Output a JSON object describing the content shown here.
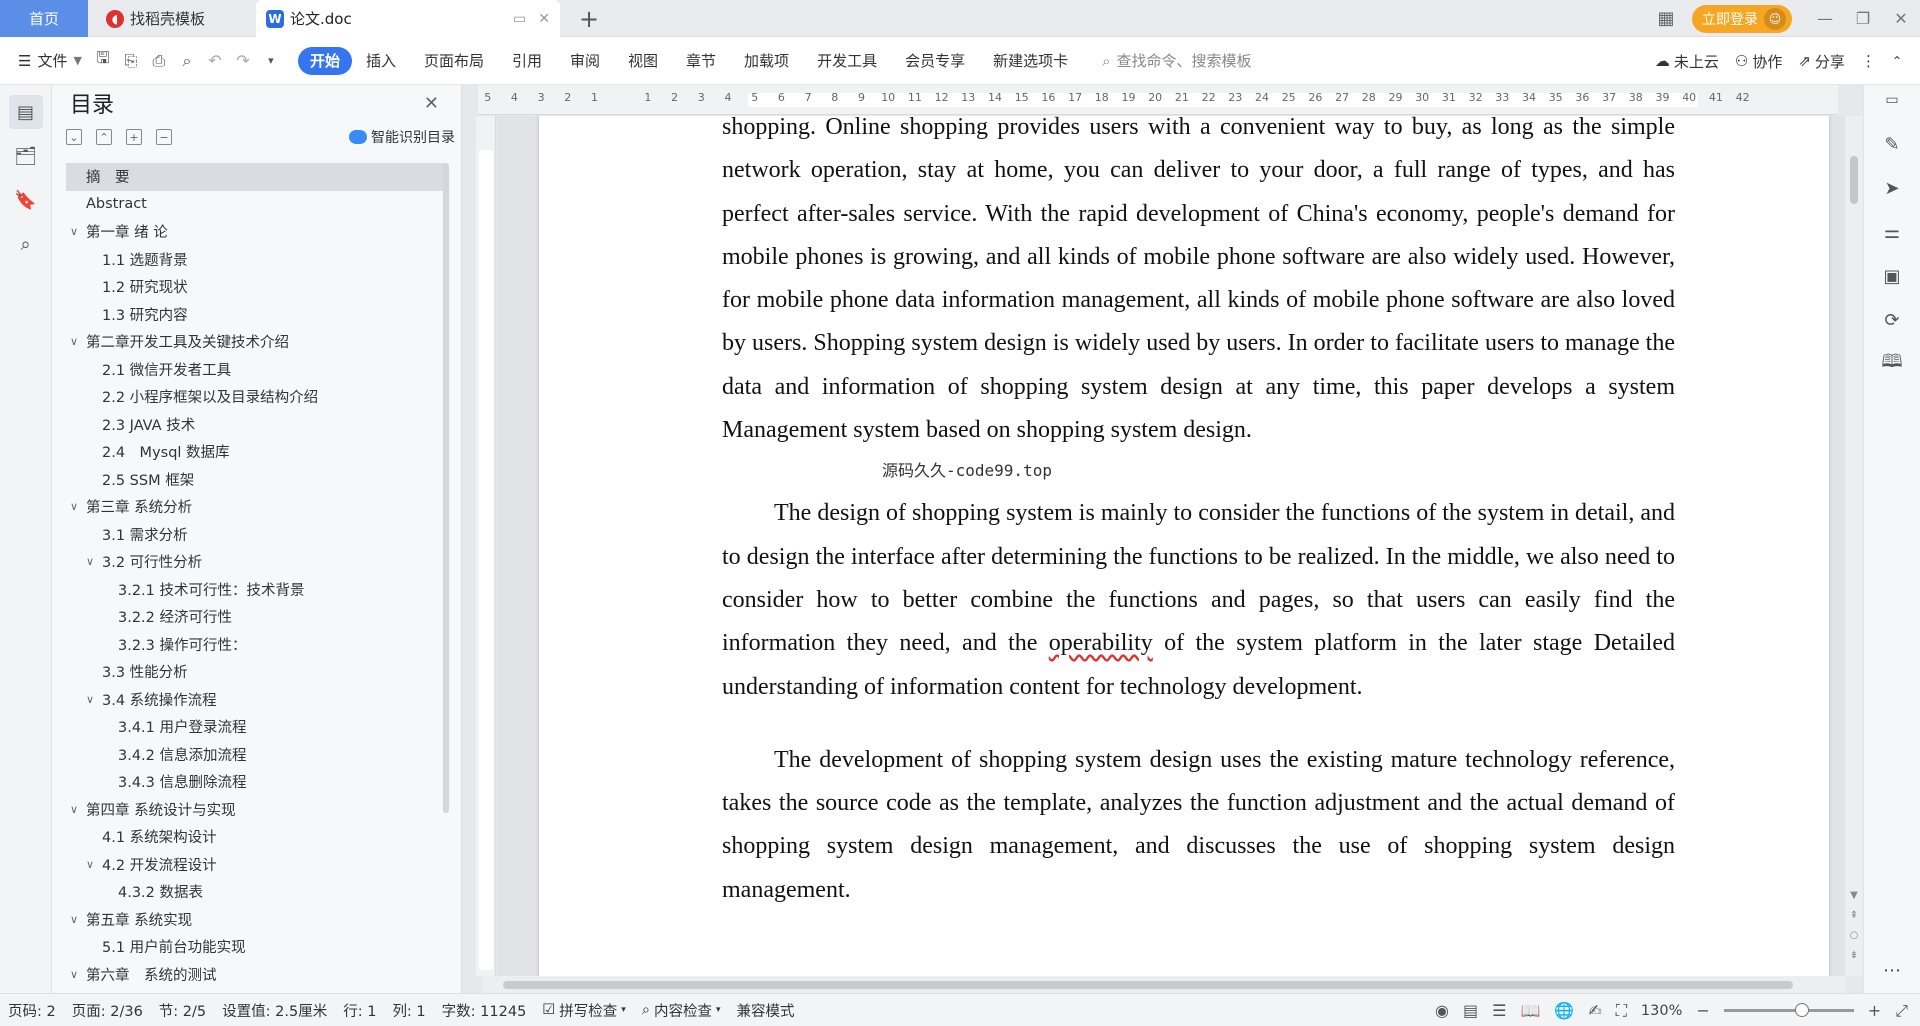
{
  "tabs": {
    "home": "首页",
    "template": "找稻壳模板",
    "doc": "论文.doc",
    "doc_tools": [
      "▭",
      "✕"
    ],
    "new_tab": "+"
  },
  "header_right": {
    "login_label": "立即登录"
  },
  "menubar": {
    "file_label": "文件",
    "items": [
      "开始",
      "插入",
      "页面布局",
      "引用",
      "审阅",
      "视图",
      "章节",
      "加载项",
      "开发工具",
      "会员专享",
      "新建选项卡"
    ],
    "active_index": 0,
    "search_placeholder": "查找命令、搜索模板",
    "cloud_label": "未上云",
    "collab_label": "协作",
    "share_label": "分享"
  },
  "toc": {
    "title": "目录",
    "smart_label": "智能识别目录",
    "items": [
      {
        "label": "摘　要",
        "level": 1,
        "expand": false,
        "selected": true
      },
      {
        "label": "Abstract",
        "level": 1,
        "expand": false
      },
      {
        "label": "第一章 绪 论",
        "level": 1,
        "expand": true
      },
      {
        "label": "1.1 选题背景",
        "level": 2,
        "expand": false
      },
      {
        "label": "1.2 研究现状",
        "level": 2,
        "expand": false
      },
      {
        "label": "1.3 研究内容",
        "level": 2,
        "expand": false
      },
      {
        "label": "第二章开发工具及关键技术介绍",
        "level": 1,
        "expand": true
      },
      {
        "label": "2.1 微信开发者工具",
        "level": 2,
        "expand": false
      },
      {
        "label": "2.2 小程序框架以及目录结构介绍",
        "level": 2,
        "expand": false
      },
      {
        "label": "2.3 JAVA 技术",
        "level": 2,
        "expand": false
      },
      {
        "label": "2.4　Mysql 数据库",
        "level": 2,
        "expand": false
      },
      {
        "label": "2.5 SSM 框架",
        "level": 2,
        "expand": false
      },
      {
        "label": "第三章 系统分析",
        "level": 1,
        "expand": true
      },
      {
        "label": "3.1 需求分析",
        "level": 2,
        "expand": false
      },
      {
        "label": "3.2 可行性分析",
        "level": 2,
        "expand": true
      },
      {
        "label": "3.2.1 技术可行性：技术背景",
        "level": 3,
        "expand": false
      },
      {
        "label": "3.2.2 经济可行性",
        "level": 3,
        "expand": false
      },
      {
        "label": "3.2.3 操作可行性：",
        "level": 3,
        "expand": false
      },
      {
        "label": "3.3 性能分析",
        "level": 2,
        "expand": false
      },
      {
        "label": "3.4 系统操作流程",
        "level": 2,
        "expand": true
      },
      {
        "label": "3.4.1 用户登录流程",
        "level": 3,
        "expand": false
      },
      {
        "label": "3.4.2 信息添加流程",
        "level": 3,
        "expand": false
      },
      {
        "label": "3.4.3 信息删除流程",
        "level": 3,
        "expand": false
      },
      {
        "label": "第四章 系统设计与实现",
        "level": 1,
        "expand": true
      },
      {
        "label": "4.1 系统架构设计",
        "level": 2,
        "expand": false
      },
      {
        "label": "4.2 开发流程设计",
        "level": 2,
        "expand": true
      },
      {
        "label": "4.3.2 数据表",
        "level": 3,
        "expand": false
      },
      {
        "label": "第五章 系统实现",
        "level": 1,
        "expand": true
      },
      {
        "label": "5.1 用户前台功能实现",
        "level": 2,
        "expand": false
      },
      {
        "label": "第六章　系统的测试",
        "level": 1,
        "expand": true
      }
    ]
  },
  "ruler": {
    "ticks": [
      "6",
      "5",
      "4",
      "3",
      "2",
      "1",
      "",
      "1",
      "2",
      "3",
      "4",
      "5",
      "6",
      "7",
      "8",
      "9",
      "10",
      "11",
      "12",
      "13",
      "14",
      "15",
      "16",
      "17",
      "18",
      "19",
      "20",
      "21",
      "22",
      "23",
      "24",
      "25",
      "26",
      "27",
      "28",
      "29",
      "30",
      "31",
      "32",
      "33",
      "34",
      "35",
      "36",
      "37",
      "38",
      "39",
      "40",
      "41",
      "42"
    ]
  },
  "document": {
    "para1": "shopping. Online shopping provides users with a convenient way to buy, as long as the simple network operation, stay at home, you can deliver to your door, a full range of types, and has perfect after-sales service. With the rapid development of China's economy, people's demand for mobile phones is growing, and all kinds of mobile phone software are also widely used. However, for mobile phone data information management, all kinds of mobile phone software are also loved by users. Shopping system design is widely used by users. In order to facilitate users to manage the data and information of shopping system design at any time, this paper develops a system Management system based on shopping system design.",
    "watermark": "源码久久-code99.top",
    "para2_a": "The design of shopping system is mainly to consider the functions of the system in detail, and to design the interface after determining the functions to be realized. In the middle, we also need to consider how to better combine the functions and pages, so that users can easily find the information they need, and the ",
    "para2_misspelled": "operability",
    "para2_b": " of the system platform in the later stage Detailed understanding of information content for technology development.",
    "para3": "The development of shopping system design uses the existing mature technology reference, takes the source code as the template, analyzes the function adjustment and the actual demand of shopping system design management, and discusses the use of shopping system design management."
  },
  "statusbar": {
    "page_no": "页码: 2",
    "page": "页面: 2/36",
    "section": "节: 2/5",
    "setting": "设置值: 2.5厘米",
    "row": "行: 1",
    "col": "列: 1",
    "words": "字数: 11245",
    "spell": "拼写检查",
    "content_check": "内容检查",
    "compat": "兼容模式",
    "zoom": "130%",
    "zoom_level": 0.6
  }
}
